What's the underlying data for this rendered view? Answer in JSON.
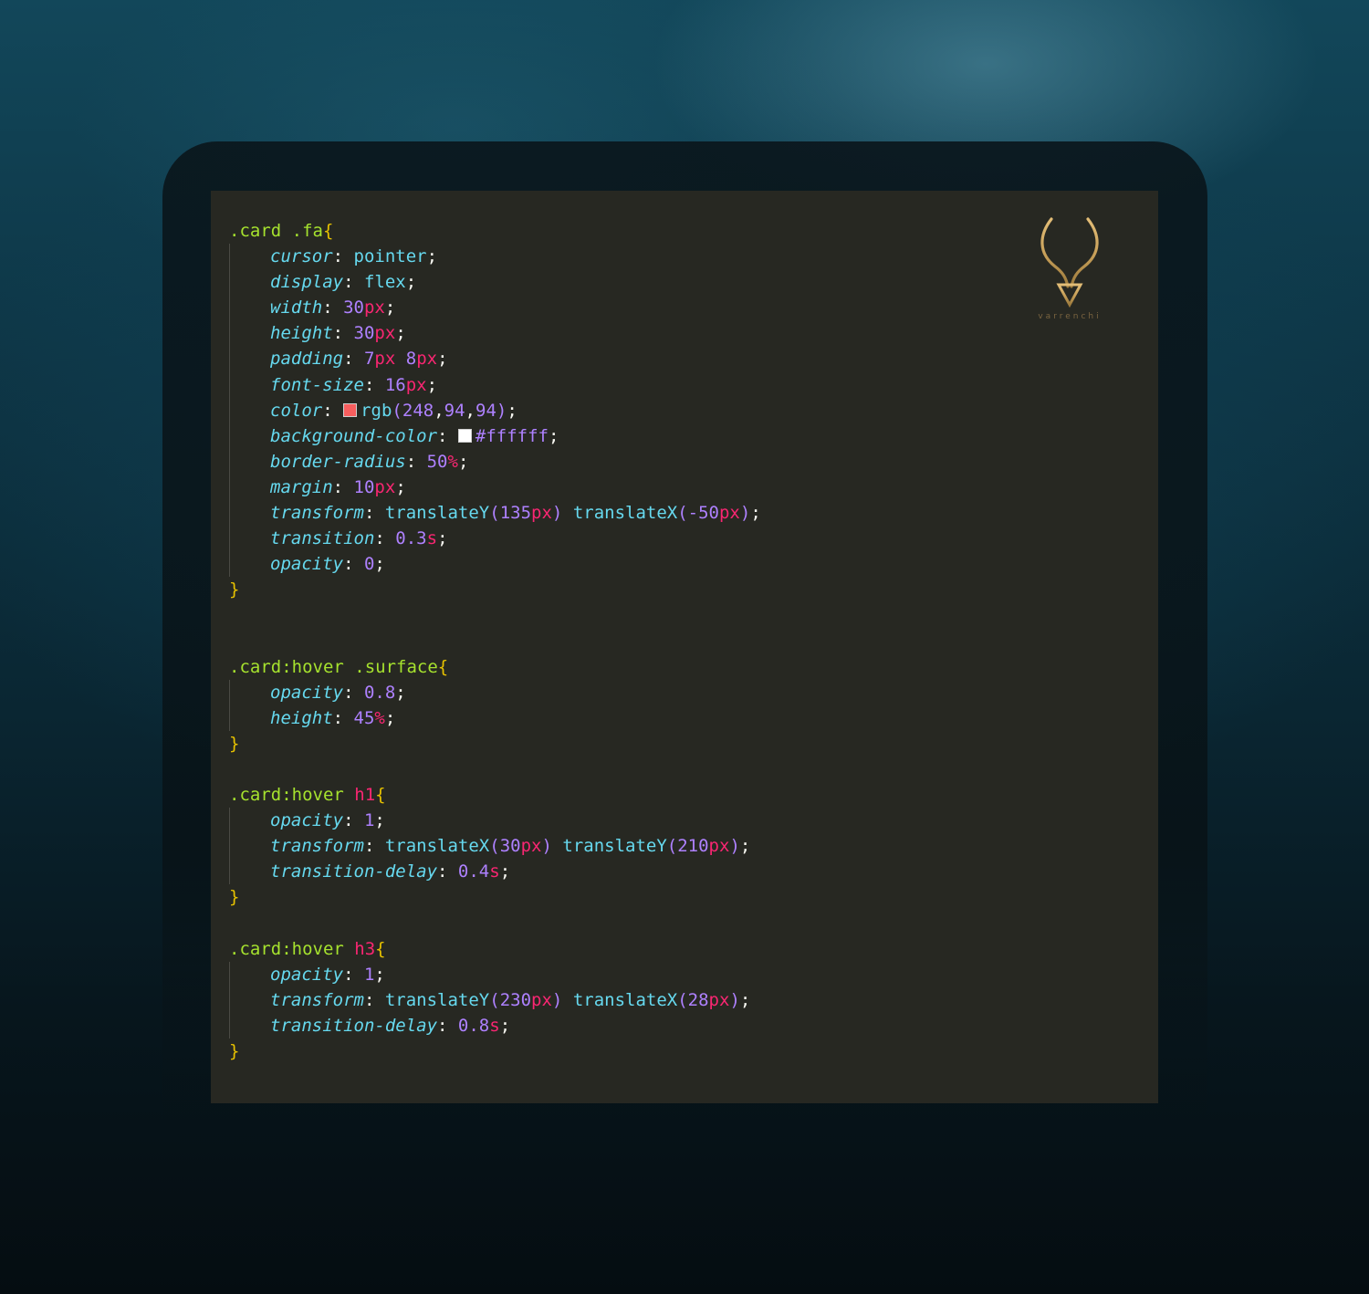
{
  "logo": {
    "icon": "horned-v-logo-icon",
    "wordmark": "varrenchi",
    "color": "#c9a15a"
  },
  "colors": {
    "editor_background": "#272822",
    "selector": "#a6e22e",
    "tag": "#f92672",
    "brace": "#e6c100",
    "property": "#66d9ef",
    "number": "#ae81ff",
    "unit": "#f92672"
  },
  "blocks": [
    {
      "selector": ".card .fa",
      "tag": "",
      "open": "{",
      "close": "}",
      "declarations": [
        {
          "prop": "cursor",
          "parts": [
            {
              "t": "val",
              "v": "pointer"
            }
          ]
        },
        {
          "prop": "display",
          "parts": [
            {
              "t": "val",
              "v": "flex"
            }
          ]
        },
        {
          "prop": "width",
          "parts": [
            {
              "t": "num",
              "v": "30"
            },
            {
              "t": "unit",
              "v": "px"
            }
          ]
        },
        {
          "prop": "height",
          "parts": [
            {
              "t": "num",
              "v": "30"
            },
            {
              "t": "unit",
              "v": "px"
            }
          ]
        },
        {
          "prop": "padding",
          "parts": [
            {
              "t": "num",
              "v": "7"
            },
            {
              "t": "unit",
              "v": "px"
            },
            {
              "t": "space",
              "v": " "
            },
            {
              "t": "num",
              "v": "8"
            },
            {
              "t": "unit",
              "v": "px"
            }
          ]
        },
        {
          "prop": "font-size",
          "parts": [
            {
              "t": "num",
              "v": "16"
            },
            {
              "t": "unit",
              "v": "px"
            }
          ]
        },
        {
          "prop": "color",
          "parts": [
            {
              "t": "swatch",
              "v": "#f85e5e"
            },
            {
              "t": "fn",
              "v": "rgb"
            },
            {
              "t": "paren",
              "v": "("
            },
            {
              "t": "num",
              "v": "248"
            },
            {
              "t": "punc",
              "v": ","
            },
            {
              "t": "num",
              "v": "94"
            },
            {
              "t": "punc",
              "v": ","
            },
            {
              "t": "num",
              "v": "94"
            },
            {
              "t": "paren",
              "v": ")"
            }
          ]
        },
        {
          "prop": "background-color",
          "parts": [
            {
              "t": "swatch",
              "v": "#ffffff"
            },
            {
              "t": "hex",
              "v": "#ffffff"
            }
          ]
        },
        {
          "prop": "border-radius",
          "parts": [
            {
              "t": "num",
              "v": "50"
            },
            {
              "t": "unit",
              "v": "%"
            }
          ]
        },
        {
          "prop": "margin",
          "parts": [
            {
              "t": "num",
              "v": "10"
            },
            {
              "t": "unit",
              "v": "px"
            }
          ]
        },
        {
          "prop": "transform",
          "parts": [
            {
              "t": "fn",
              "v": "translateY"
            },
            {
              "t": "paren",
              "v": "("
            },
            {
              "t": "num",
              "v": "135"
            },
            {
              "t": "unit",
              "v": "px"
            },
            {
              "t": "paren",
              "v": ")"
            },
            {
              "t": "space",
              "v": " "
            },
            {
              "t": "fn",
              "v": "translateX"
            },
            {
              "t": "paren",
              "v": "("
            },
            {
              "t": "num",
              "v": "-50"
            },
            {
              "t": "unit",
              "v": "px"
            },
            {
              "t": "paren",
              "v": ")"
            }
          ]
        },
        {
          "prop": "transition",
          "parts": [
            {
              "t": "num",
              "v": "0.3"
            },
            {
              "t": "unit",
              "v": "s"
            }
          ]
        },
        {
          "prop": "opacity",
          "parts": [
            {
              "t": "num",
              "v": "0"
            }
          ]
        }
      ],
      "blank_after": 2
    },
    {
      "selector": ".card:hover .surface",
      "tag": "",
      "open": "{",
      "close": "}",
      "declarations": [
        {
          "prop": "opacity",
          "parts": [
            {
              "t": "num",
              "v": "0.8"
            }
          ]
        },
        {
          "prop": "height",
          "parts": [
            {
              "t": "num",
              "v": "45"
            },
            {
              "t": "unit",
              "v": "%"
            }
          ]
        }
      ],
      "blank_after": 1
    },
    {
      "selector": ".card:hover ",
      "tag": "h1",
      "open": "{",
      "close": "}",
      "declarations": [
        {
          "prop": "opacity",
          "parts": [
            {
              "t": "num",
              "v": "1"
            }
          ]
        },
        {
          "prop": "transform",
          "parts": [
            {
              "t": "fn",
              "v": "translateX"
            },
            {
              "t": "paren",
              "v": "("
            },
            {
              "t": "num",
              "v": "30"
            },
            {
              "t": "unit",
              "v": "px"
            },
            {
              "t": "paren",
              "v": ")"
            },
            {
              "t": "space",
              "v": " "
            },
            {
              "t": "fn",
              "v": "translateY"
            },
            {
              "t": "paren",
              "v": "("
            },
            {
              "t": "num",
              "v": "210"
            },
            {
              "t": "unit",
              "v": "px"
            },
            {
              "t": "paren",
              "v": ")"
            }
          ]
        },
        {
          "prop": "transition-delay",
          "parts": [
            {
              "t": "num",
              "v": "0.4"
            },
            {
              "t": "unit",
              "v": "s"
            }
          ]
        }
      ],
      "blank_after": 1
    },
    {
      "selector": ".card:hover ",
      "tag": "h3",
      "open": "{",
      "close": "}",
      "declarations": [
        {
          "prop": "opacity",
          "parts": [
            {
              "t": "num",
              "v": "1"
            }
          ]
        },
        {
          "prop": "transform",
          "parts": [
            {
              "t": "fn",
              "v": "translateY"
            },
            {
              "t": "paren",
              "v": "("
            },
            {
              "t": "num",
              "v": "230"
            },
            {
              "t": "unit",
              "v": "px"
            },
            {
              "t": "paren",
              "v": ")"
            },
            {
              "t": "space",
              "v": " "
            },
            {
              "t": "fn",
              "v": "translateX"
            },
            {
              "t": "paren",
              "v": "("
            },
            {
              "t": "num",
              "v": "28"
            },
            {
              "t": "unit",
              "v": "px"
            },
            {
              "t": "paren",
              "v": ")"
            }
          ]
        },
        {
          "prop": "transition-delay",
          "parts": [
            {
              "t": "num",
              "v": "0.8"
            },
            {
              "t": "unit",
              "v": "s"
            }
          ]
        }
      ],
      "blank_after": 0
    }
  ]
}
